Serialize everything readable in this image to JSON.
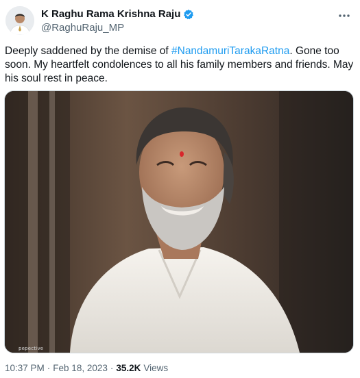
{
  "author": {
    "display_name": "K Raghu Rama Krishna Raju",
    "handle": "@RaghuRaju_MP",
    "verified": true
  },
  "tweet": {
    "text_before": "Deeply saddened by the demise of ",
    "hashtag": "#NandamuriTarakaRatna",
    "text_after": ". Gone too soon. My heartfelt condolences to all his family members and friends. May his soul rest in peace."
  },
  "media": {
    "watermark": "pepective"
  },
  "meta": {
    "time": "10:37 PM",
    "separator": "·",
    "date": "Feb 18, 2023",
    "views_count": "35.2K",
    "views_label": "Views"
  },
  "colors": {
    "accent": "#1d9bf0",
    "secondary_text": "#536471"
  },
  "icons": {
    "verified": "verified-badge-icon",
    "more": "more-options-icon"
  }
}
